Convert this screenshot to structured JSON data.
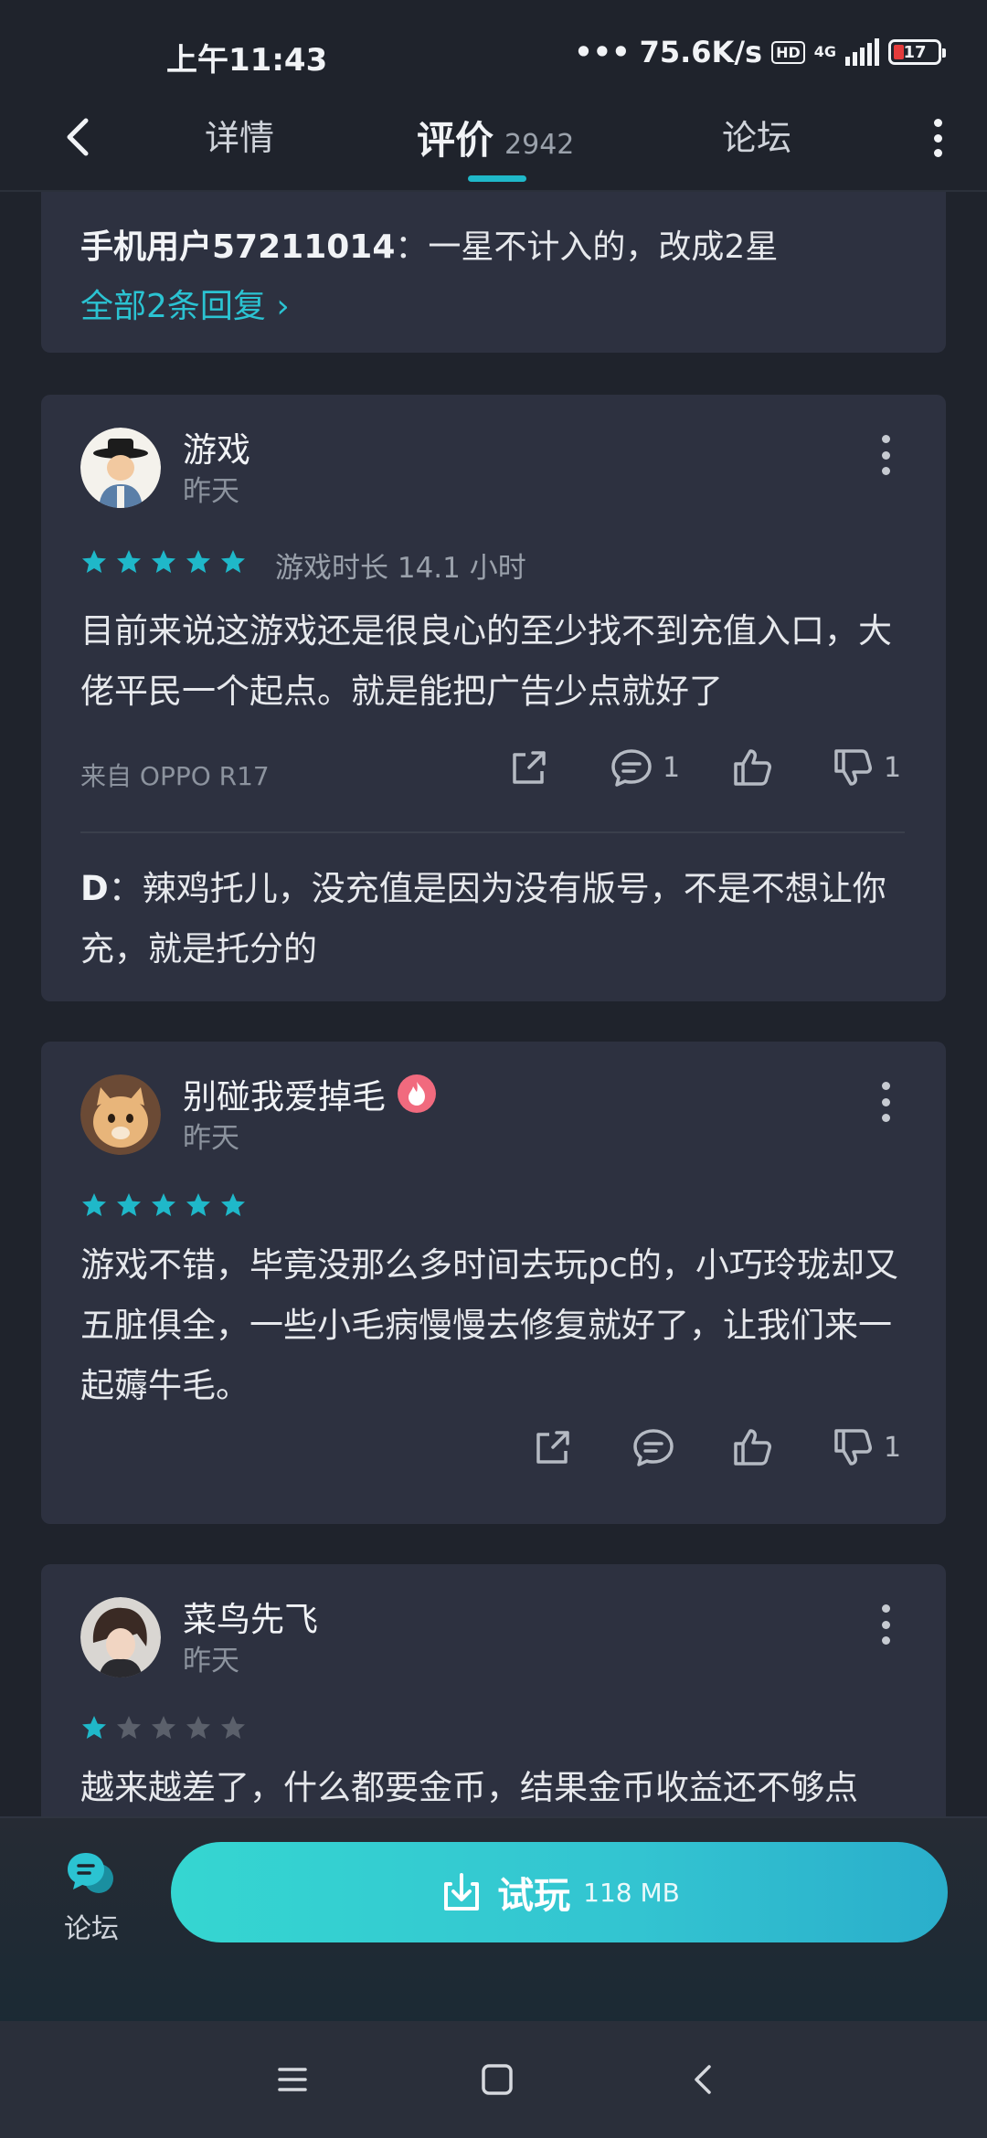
{
  "status": {
    "time": "上午11:43",
    "speed": "75.6K/s",
    "hd": "HD",
    "network": "4G",
    "battery": "17"
  },
  "nav": {
    "tab_detail": "详情",
    "tab_reviews": "评价",
    "review_count": "2942",
    "tab_forum": "论坛"
  },
  "top_reply": {
    "user": "手机用户57211014",
    "sep": "：",
    "text": "一星不计入的，改成2星",
    "all_replies": "全部2条回复 ›"
  },
  "reviews": [
    {
      "user": "游戏",
      "date": "昨天",
      "stars": 5,
      "playtime": "游戏时长 14.1 小时",
      "content": "目前来说这游戏还是很良心的至少找不到充值入口，大佬平民一个起点。就是能把广告少点就好了",
      "device": "来自 OPPO R17",
      "comments": "1",
      "dislikes": "1",
      "reply": {
        "user": "D",
        "sep": "：",
        "text": "辣鸡托儿，没充值是因为没有版号，不是不想让你充，就是托分的"
      }
    },
    {
      "user": "别碰我爱掉毛",
      "date": "昨天",
      "stars": 5,
      "content": "游戏不错，毕竟没那么多时间去玩pc的，小巧玲珑却又五脏俱全，一些小毛病慢慢去修复就好了，让我们来一起薅牛毛。",
      "dislikes": "1"
    },
    {
      "user": "菜鸟先飞",
      "date": "昨天",
      "stars": 1,
      "content": "越来越差了，什么都要金币，结果金币收益还不够点"
    }
  ],
  "bottom": {
    "forum_label": "论坛",
    "try_label": "试玩",
    "size": "118 MB"
  },
  "colors": {
    "accent": "#1fb8c9",
    "card": "#2d3140",
    "background": "#1f232c",
    "star_on": "#1fb8c9",
    "star_off": "#5b606b"
  }
}
